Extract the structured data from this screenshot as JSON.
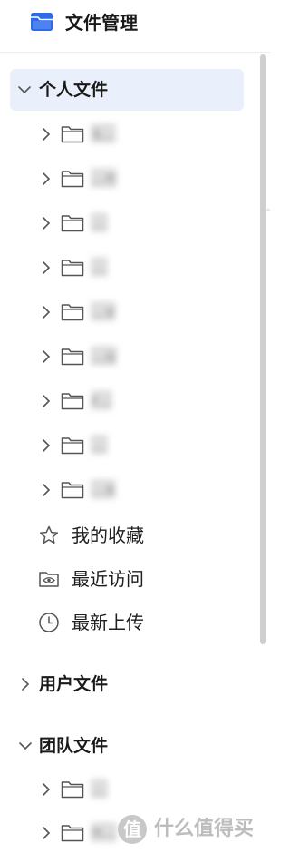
{
  "header": {
    "title": "文件管理",
    "icon": "app-folder-icon",
    "icon_color": "#2f6be8"
  },
  "sections": [
    {
      "label": "个人文件",
      "expanded": true,
      "selected": true
    },
    {
      "label": "用户文件",
      "expanded": false,
      "selected": false
    },
    {
      "label": "团队文件",
      "expanded": true,
      "selected": false
    }
  ],
  "personal_folders": [
    {
      "name": "s..."
    },
    {
      "name": "...n"
    },
    {
      "name": "..."
    },
    {
      "name": "..."
    },
    {
      "name": "...v"
    },
    {
      "name": "...u"
    },
    {
      "name": "r..."
    },
    {
      "name": "..."
    },
    {
      "name": "...s"
    }
  ],
  "quick_links": [
    {
      "label": "我的收藏",
      "icon": "star-icon"
    },
    {
      "label": "最近访问",
      "icon": "eye-icon"
    },
    {
      "label": "最新上传",
      "icon": "clock-icon"
    }
  ],
  "team_folders": [
    {
      "name": "..."
    },
    {
      "name": "n..."
    }
  ],
  "watermark": {
    "text": "什么值得买",
    "icon": "zdm-logo-icon"
  },
  "colors": {
    "selected_bg": "#e9effb",
    "accent": "#2f6be8",
    "icon_gray": "#555555",
    "divider": "#ededed"
  }
}
